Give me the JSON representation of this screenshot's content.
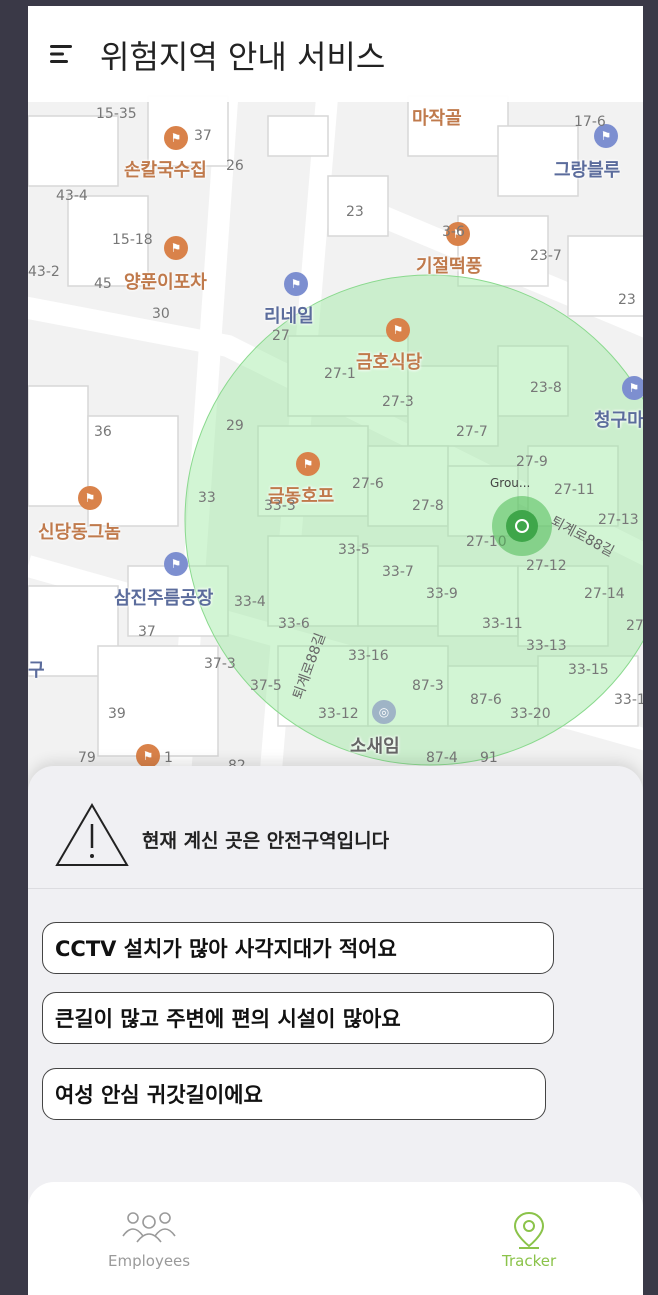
{
  "header": {
    "title": "위험지역 안내 서비스"
  },
  "map": {
    "pois": [
      {
        "name": "손칼국수집",
        "color": "orange"
      },
      {
        "name": "양푼이포차",
        "color": "orange"
      },
      {
        "name": "리네일",
        "color": "blue"
      },
      {
        "name": "금호식당",
        "color": "orange"
      },
      {
        "name": "기절떡풍",
        "color": "orange"
      },
      {
        "name": "마작골",
        "color": "orange"
      },
      {
        "name": "그랑블루",
        "color": "blue"
      },
      {
        "name": "청구마",
        "color": "blue"
      },
      {
        "name": "금동호프",
        "color": "orange"
      },
      {
        "name": "신당동그놈",
        "color": "orange"
      },
      {
        "name": "삼진주름공장",
        "color": "blue"
      },
      {
        "name": "소새임",
        "color": "gray"
      },
      {
        "name": "구",
        "color": "blue"
      }
    ],
    "lot_numbers": [
      "15-35",
      "37",
      "26",
      "17-6",
      "43-4",
      "23",
      "15-18",
      "3-6",
      "23-7",
      "43-2",
      "45",
      "30",
      "23",
      "27",
      "27-1",
      "23-8",
      "27-3",
      "36",
      "29",
      "27-7",
      "27-9",
      "27-6",
      "27-11",
      "33",
      "33-3",
      "27-8",
      "27-13",
      "27-10",
      "33-5",
      "27-12",
      "33-7",
      "33-9",
      "27-14",
      "33-4",
      "37",
      "33-6",
      "33-11",
      "33-13",
      "33-16",
      "27",
      "37-3",
      "87-3",
      "33-15",
      "37-5",
      "87-6",
      "33-1",
      "39",
      "33-12",
      "33-20",
      "79",
      "1",
      "82",
      "87-4",
      "91"
    ],
    "road_labels": [
      "퇴계로88길",
      "퇴계로88길"
    ],
    "current_location": {
      "label": "Grou..."
    },
    "safe_zone_color": "#9be89f"
  },
  "status": {
    "warning_icon": "warning-triangle-icon",
    "message": "현재 계신 곳은 안전구역입니다"
  },
  "reasons": [
    "CCTV 설치가 많아 사각지대가 적어요",
    "큰길이 많고 주변에 편의 시설이 많아요",
    "여성 안심 귀갓길이에요"
  ],
  "nav": {
    "items": [
      {
        "label": "Employees",
        "icon": "people-icon",
        "active": false
      },
      {
        "label": "Tracker",
        "icon": "location-pin-icon",
        "active": true
      }
    ],
    "active_color": "#8bc34a",
    "inactive_color": "#9a9a9a"
  }
}
